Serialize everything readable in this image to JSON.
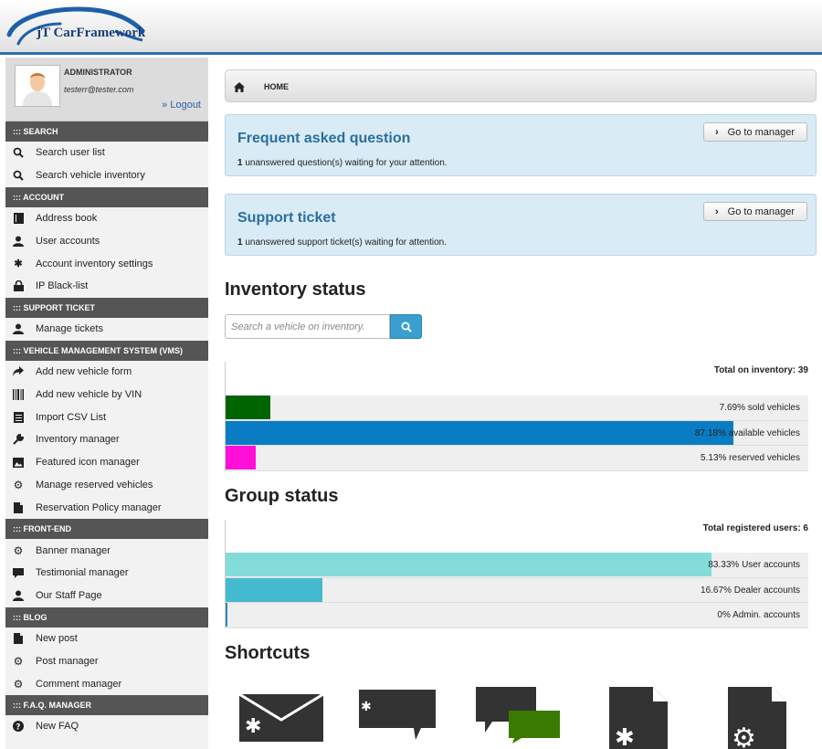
{
  "header": {
    "logo_text": "jT CarFramework"
  },
  "profile": {
    "name": "ADMINISTRATOR",
    "email": "testerr@tester.com",
    "logout": "» Logout"
  },
  "sidebar": {
    "sections": [
      {
        "title": "::: SEARCH",
        "items": [
          {
            "label": "Search user list",
            "icon": "search-icon"
          },
          {
            "label": "Search vehicle inventory",
            "icon": "search-icon"
          }
        ]
      },
      {
        "title": "::: ACCOUNT",
        "items": [
          {
            "label": "Address book",
            "icon": "book-icon"
          },
          {
            "label": "User accounts",
            "icon": "user-icon"
          },
          {
            "label": "Account inventory settings",
            "icon": "asterisk-icon"
          },
          {
            "label": "IP Black-list",
            "icon": "lock-icon"
          }
        ]
      },
      {
        "title": "::: SUPPORT TICKET",
        "items": [
          {
            "label": "Manage tickets",
            "icon": "user-icon"
          }
        ]
      },
      {
        "title": "::: VEHICLE MANAGEMENT SYSTEM (VMS)",
        "items": [
          {
            "label": "Add new vehicle form",
            "icon": "share-arrow-icon"
          },
          {
            "label": "Add new vehicle by VIN",
            "icon": "barcode-icon"
          },
          {
            "label": "Import CSV List",
            "icon": "list-icon"
          },
          {
            "label": "Inventory manager",
            "icon": "wrench-icon"
          },
          {
            "label": "Featured icon manager",
            "icon": "picture-icon"
          },
          {
            "label": "Manage reserved vehicles",
            "icon": "cog-icon"
          },
          {
            "label": "Reservation Policy manager",
            "icon": "file-icon"
          }
        ]
      },
      {
        "title": "::: FRONT-END",
        "items": [
          {
            "label": "Banner manager",
            "icon": "cog-icon"
          },
          {
            "label": "Testimonial manager",
            "icon": "comment-icon"
          },
          {
            "label": "Our Staff Page",
            "icon": "user-icon"
          }
        ]
      },
      {
        "title": "::: BLOG",
        "items": [
          {
            "label": "New post",
            "icon": "file-icon"
          },
          {
            "label": "Post manager",
            "icon": "cog-icon"
          },
          {
            "label": "Comment manager",
            "icon": "cog-icon"
          }
        ]
      },
      {
        "title": "::: F.A.Q. MANAGER",
        "items": [
          {
            "label": "New FAQ",
            "icon": "question-icon"
          }
        ]
      }
    ]
  },
  "breadcrumb": {
    "home": "HOME"
  },
  "faq_box": {
    "title": "Frequent asked question",
    "count": "1",
    "text": " unanswered question(s) waiting for your attention.",
    "button": "Go to manager"
  },
  "ticket_box": {
    "title": "Support ticket",
    "count": "1",
    "text": " unanswered support ticket(s) waiting for attention.",
    "button": "Go to manager"
  },
  "inventory": {
    "heading": "Inventory status",
    "search_placeholder": "Search a vehicle on inventory.",
    "total_label": "Total on inventory: 39",
    "bars": [
      {
        "label": "7.69% sold vehicles",
        "percent": 7.69,
        "color": "#006400"
      },
      {
        "label": "87.18% available vehicles",
        "percent": 87.18,
        "color": "#0a7cc4"
      },
      {
        "label": "5.13% reserved vehicles",
        "percent": 5.13,
        "color": "#ff10d8"
      }
    ]
  },
  "group": {
    "heading": "Group status",
    "total_label": "Total registered users: 6",
    "bars": [
      {
        "label": "83.33% User accounts",
        "percent": 83.33,
        "color": "#84dcd8"
      },
      {
        "label": "16.67% Dealer accounts",
        "percent": 16.67,
        "color": "#45b9cf"
      },
      {
        "label": "0% Admin. accounts",
        "percent": 0,
        "color": "#2e8bb5"
      }
    ]
  },
  "shortcuts": {
    "heading": "Shortcuts",
    "icons": [
      "envelope-icon",
      "chat-bubble-icon",
      "conversation-icon",
      "document-asterisk-icon",
      "document-gear-icon"
    ]
  }
}
